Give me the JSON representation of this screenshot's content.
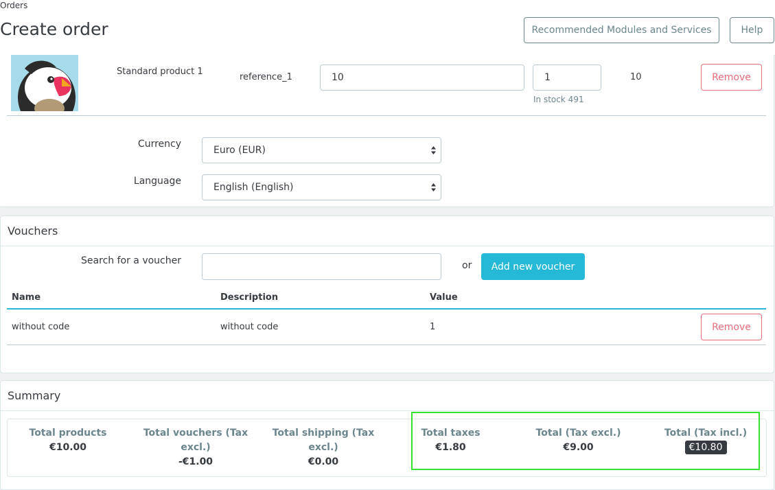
{
  "header": {
    "breadcrumb": "Orders",
    "title": "Create order",
    "recommended_label": "Recommended Modules and Services",
    "help_label": "Help"
  },
  "cart": {
    "product": {
      "image_icon": "puffin-logo",
      "name": "Standard product 1",
      "reference": "reference_1",
      "price": "10",
      "quantity": "1",
      "stock": "In stock 491",
      "total": "10",
      "remove_label": "Remove"
    },
    "currency_label": "Currency",
    "currency_value": "Euro (EUR)",
    "language_label": "Language",
    "language_value": "English (English)"
  },
  "vouchers": {
    "title": "Vouchers",
    "search_label": "Search for a voucher",
    "search_value": "",
    "or_text": "or",
    "add_label": "Add new voucher",
    "columns": [
      "Name",
      "Description",
      "Value"
    ],
    "rows": [
      {
        "name": "without code",
        "description": "without code",
        "value": "1",
        "remove_label": "Remove"
      }
    ]
  },
  "summary": {
    "title": "Summary",
    "total_products_label": "Total products",
    "total_products_value": "€10.00",
    "total_vouchers_label": "Total vouchers (Tax excl.)",
    "total_vouchers_value": "-€1.00",
    "total_shipping_label": "Total shipping (Tax excl.)",
    "total_shipping_value": "€0.00",
    "total_taxes_label": "Total taxes",
    "total_taxes_value": "€1.80",
    "total_excl_label": "Total (Tax excl.)",
    "total_excl_value": "€9.00",
    "total_incl_label": "Total (Tax incl.)",
    "total_incl_value": "€10.80"
  },
  "colors": {
    "primary": "#25b9d7",
    "danger": "#e76d7a",
    "highlight": "#32e332"
  }
}
